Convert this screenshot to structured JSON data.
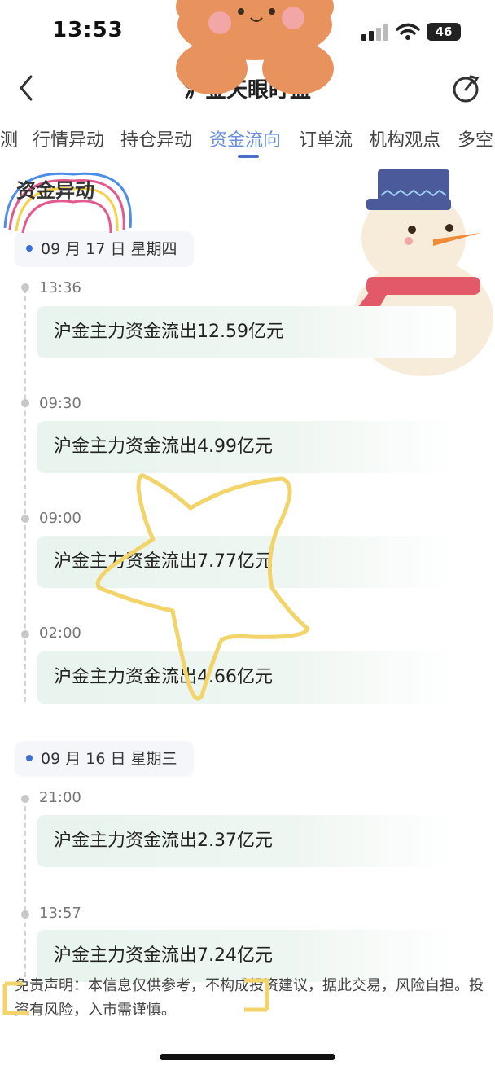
{
  "status_bar": {
    "time": "13:53",
    "battery": "46"
  },
  "nav": {
    "title": "沪金天眼盯盘"
  },
  "tabs": [
    "测",
    "行情异动",
    "持仓异动",
    "资金流向",
    "订单流",
    "机构观点",
    "多空"
  ],
  "active_tab": "资金流向",
  "section_title": "资金异动",
  "groups": [
    {
      "date": "09 月 17 日 星期四",
      "events": [
        {
          "time": "13:36",
          "text": "沪金主力资金流出12.59亿元"
        },
        {
          "time": "09:30",
          "text": "沪金主力资金流出4.99亿元"
        },
        {
          "time": "09:00",
          "text": "沪金主力资金流出7.77亿元"
        },
        {
          "time": "02:00",
          "text": "沪金主力资金流出4.66亿元"
        }
      ]
    },
    {
      "date": "09 月 16 日 星期三",
      "events": [
        {
          "time": "21:00",
          "text": "沪金主力资金流出2.37亿元"
        },
        {
          "time": "13:57",
          "text": "沪金主力资金流出7.24亿元"
        }
      ]
    }
  ],
  "disclaimer": "免责声明：本信息仅供参考，不构成投资建议，据此交易，风险自担。投资有风险，入市需谨慎。",
  "colors": {
    "accent": "#4a6fc9",
    "card": "#e9f4ee",
    "date_dot": "#3a6fd6"
  },
  "icons": {
    "back": "chevron-left-icon",
    "refresh": "refresh-icon"
  }
}
